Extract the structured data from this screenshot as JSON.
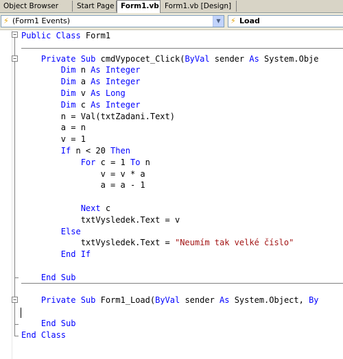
{
  "tabs": [
    {
      "label": "Object Browser",
      "active": false
    },
    {
      "label": "Start Page",
      "active": false
    },
    {
      "label": "Form1.vb",
      "active": true
    },
    {
      "label": "Form1.vb [Design]",
      "active": false
    }
  ],
  "class_combo": {
    "value": "(Form1 Events)",
    "icon": "lightning-icon"
  },
  "method_combo": {
    "value": "Load",
    "icon": "lightning-icon"
  },
  "code": [
    [
      [
        "k",
        "Public Class"
      ],
      [
        "t",
        " Form1"
      ]
    ],
    [],
    [
      [
        "t",
        "    "
      ],
      [
        "k",
        "Private Sub"
      ],
      [
        "t",
        " cmdVypocet_Click("
      ],
      [
        "k",
        "ByVal"
      ],
      [
        "t",
        " sender "
      ],
      [
        "k",
        "As"
      ],
      [
        "t",
        " System.Obje"
      ]
    ],
    [
      [
        "t",
        "        "
      ],
      [
        "k",
        "Dim"
      ],
      [
        "t",
        " n "
      ],
      [
        "k",
        "As Integer"
      ]
    ],
    [
      [
        "t",
        "        "
      ],
      [
        "k",
        "Dim"
      ],
      [
        "t",
        " a "
      ],
      [
        "k",
        "As Integer"
      ]
    ],
    [
      [
        "t",
        "        "
      ],
      [
        "k",
        "Dim"
      ],
      [
        "t",
        " v "
      ],
      [
        "k",
        "As Long"
      ]
    ],
    [
      [
        "t",
        "        "
      ],
      [
        "k",
        "Dim"
      ],
      [
        "t",
        " c "
      ],
      [
        "k",
        "As Integer"
      ]
    ],
    [
      [
        "t",
        "        n = Val(txtZadani.Text)"
      ]
    ],
    [
      [
        "t",
        "        a = n"
      ]
    ],
    [
      [
        "t",
        "        v = 1"
      ]
    ],
    [
      [
        "t",
        "        "
      ],
      [
        "k",
        "If"
      ],
      [
        "t",
        " n < 20 "
      ],
      [
        "k",
        "Then"
      ]
    ],
    [
      [
        "t",
        "            "
      ],
      [
        "k",
        "For"
      ],
      [
        "t",
        " c = 1 "
      ],
      [
        "k",
        "To"
      ],
      [
        "t",
        " n"
      ]
    ],
    [
      [
        "t",
        "                v = v * a"
      ]
    ],
    [
      [
        "t",
        "                a = a - 1"
      ]
    ],
    [],
    [
      [
        "t",
        "            "
      ],
      [
        "k",
        "Next"
      ],
      [
        "t",
        " c"
      ]
    ],
    [
      [
        "t",
        "            txtVysledek.Text = v"
      ]
    ],
    [
      [
        "t",
        "        "
      ],
      [
        "k",
        "Else"
      ]
    ],
    [
      [
        "t",
        "            txtVysledek.Text = "
      ],
      [
        "s",
        "\"Neumím tak velké číslo\""
      ]
    ],
    [
      [
        "t",
        "        "
      ],
      [
        "k",
        "End If"
      ]
    ],
    [],
    [
      [
        "t",
        "    "
      ],
      [
        "k",
        "End Sub"
      ]
    ],
    [],
    [
      [
        "t",
        "    "
      ],
      [
        "k",
        "Private Sub"
      ],
      [
        "t",
        " Form1_Load("
      ],
      [
        "k",
        "ByVal"
      ],
      [
        "t",
        " sender "
      ],
      [
        "k",
        "As"
      ],
      [
        "t",
        " System.Object, "
      ],
      [
        "k",
        "By"
      ]
    ],
    [],
    [
      [
        "t",
        "    "
      ],
      [
        "k",
        "End Sub"
      ]
    ],
    [
      [
        "k",
        "End Class"
      ]
    ]
  ]
}
